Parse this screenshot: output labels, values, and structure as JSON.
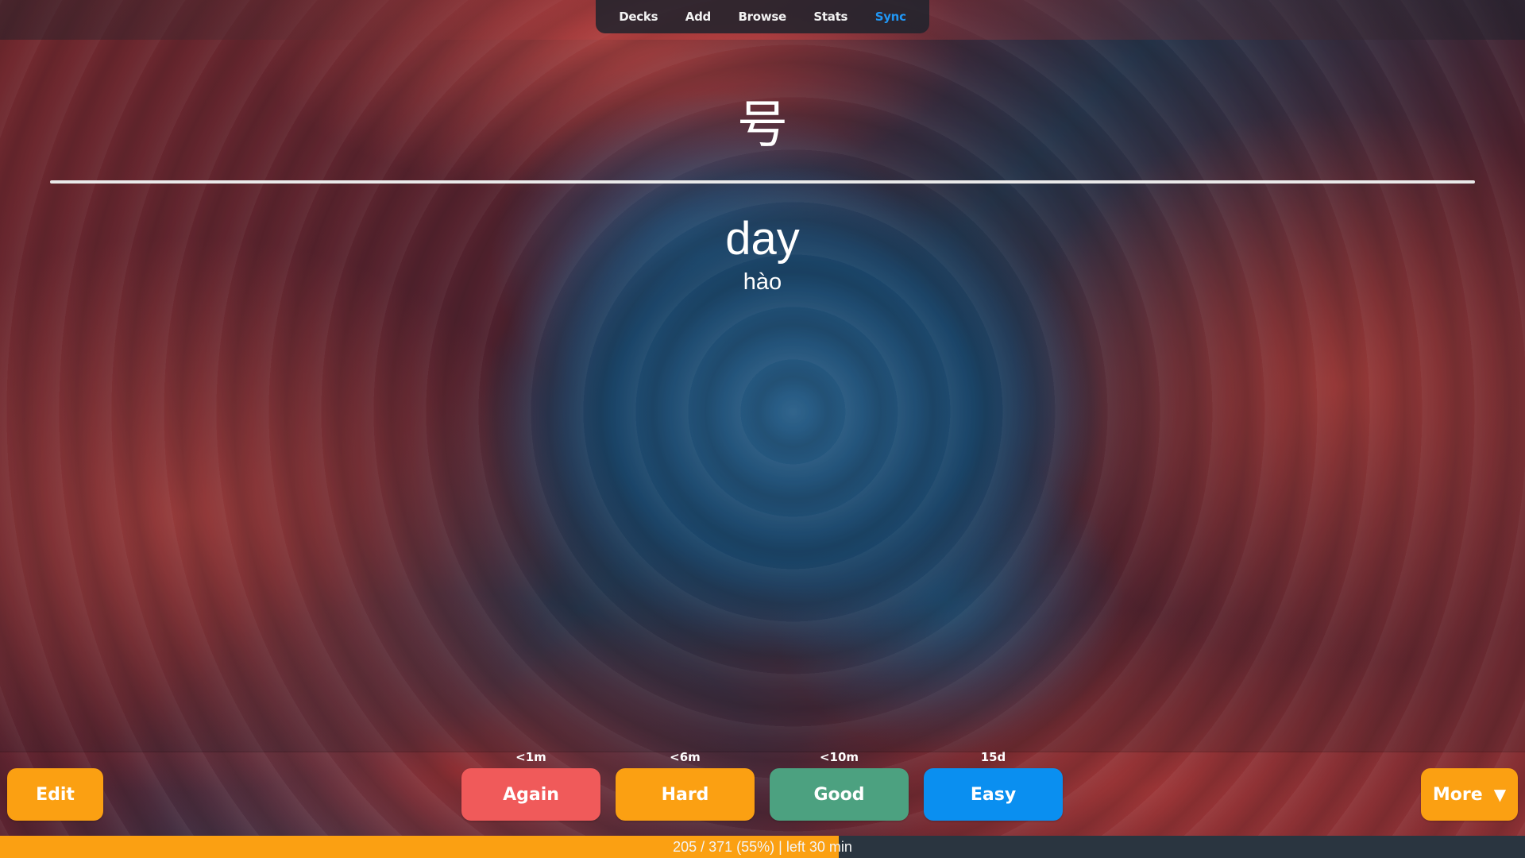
{
  "nav": {
    "items": [
      {
        "label": "Decks",
        "active": false
      },
      {
        "label": "Add",
        "active": false
      },
      {
        "label": "Browse",
        "active": false
      },
      {
        "label": "Stats",
        "active": false
      },
      {
        "label": "Sync",
        "active": true
      }
    ]
  },
  "card": {
    "question": "号",
    "answer_word": "day",
    "answer_pinyin": "hào"
  },
  "actions": {
    "edit_label": "Edit",
    "more_label": "More",
    "more_caret": "▼"
  },
  "answer_buttons": [
    {
      "label": "Again",
      "interval": "<1m",
      "color": "#f05a5a"
    },
    {
      "label": "Hard",
      "interval": "<6m",
      "color": "#fba012"
    },
    {
      "label": "Good",
      "interval": "<10m",
      "color": "#4ca180"
    },
    {
      "label": "Easy",
      "interval": "15d",
      "color": "#0a8ff0"
    }
  ],
  "progress": {
    "text": "205 / 371 (55%) | left 30 min",
    "fraction": 0.55,
    "color": "#fba012"
  },
  "colors": {
    "accent": "#2196f3"
  }
}
